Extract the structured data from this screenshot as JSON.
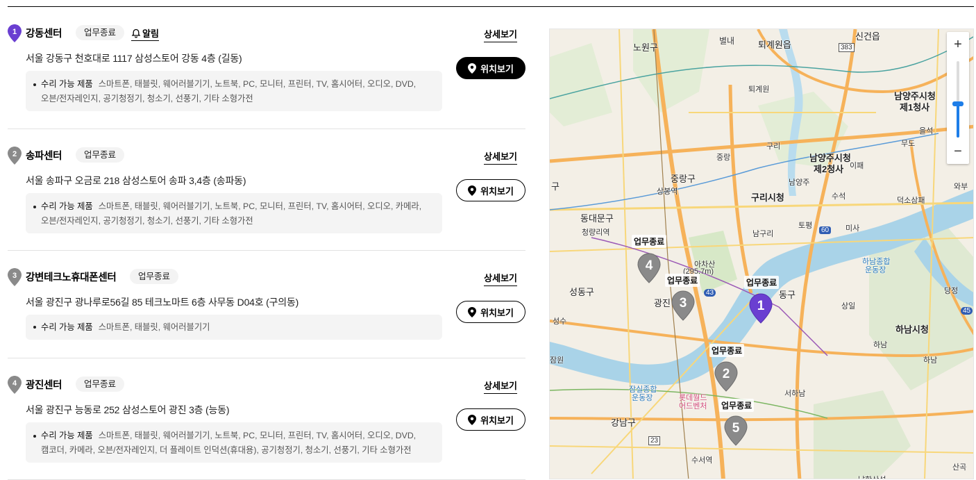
{
  "centers": [
    {
      "number": "1",
      "name": "강동센터",
      "status": "업무종료",
      "alarm_label": "알림",
      "address": "서울 강동구 천호대로 1117 삼성스토어 강동 4층 (길동)",
      "products_label": "수리 가능 제품",
      "products_line1": "스마트폰, 태블릿, 웨어러블기기, 노트북, PC, 모니터, 프린터, TV, 홈시어터, 오디오, DVD,",
      "products_line2": "오븐/전자레인지, 공기청정기, 청소기, 선풍기, 기타 소형가전",
      "detail_label": "상세보기",
      "location_label": "위치보기",
      "pin_color": "#6a3fd1"
    },
    {
      "number": "2",
      "name": "송파센터",
      "status": "업무종료",
      "address": "서울 송파구 오금로 218 삼성스토어 송파 3,4층 (송파동)",
      "products_label": "수리 가능 제품",
      "products_line1": "스마트폰, 태블릿, 웨어러블기기, 노트북, PC, 모니터, 프린터, TV, 홈시어터, 오디오, 카메라,",
      "products_line2": "오븐/전자레인지, 공기청정기, 청소기, 선풍기, 기타 소형가전",
      "detail_label": "상세보기",
      "location_label": "위치보기",
      "pin_color": "#8a8a8a"
    },
    {
      "number": "3",
      "name": "강변테크노휴대폰센터",
      "status": "업무종료",
      "address": "서울 광진구 광나루로56길 85 테크노마트 6층 사무동 D04호 (구의동)",
      "products_label": "수리 가능 제품",
      "products_line1": "스마트폰, 태블릿, 웨어러블기기",
      "products_line2": "",
      "detail_label": "상세보기",
      "location_label": "위치보기",
      "pin_color": "#8a8a8a"
    },
    {
      "number": "4",
      "name": "광진센터",
      "status": "업무종료",
      "address": "서울 광진구 능동로 252 삼성스토어 광진 3층 (능동)",
      "products_label": "수리 가능 제품",
      "products_line1": "스마트폰, 태블릿, 웨어러블기기, 노트북, PC, 모니터, 프린터, TV, 홈시어터, 오디오, DVD,",
      "products_line2": "캠코더, 카메라, 오븐/전자레인지, 더 플레이트 인덕션(휴대용), 공기청정기, 청소기, 선풍기, 기타 소형가전",
      "detail_label": "상세보기",
      "location_label": "위치보기",
      "pin_color": "#8a8a8a"
    }
  ],
  "map": {
    "labels": {
      "nowon": "노원구",
      "byeollae": "별내",
      "toegyewon": "퇴계원읍",
      "singeonji": "신건읍",
      "toegyewon_ic": "퇴계원",
      "namyangju1": "남양주시청",
      "namyangju1b": "제1청사",
      "namyangju2": "남양주시청",
      "namyangju2b": "제2청사",
      "jungnang": "중랑구",
      "sangbong": "상봉역",
      "guri": "구리시청",
      "gu": "구",
      "dongdaemun": "동대문구",
      "cheongnyangni": "청량리역",
      "achasan": "아차산",
      "achasan_h": "(295.7m)",
      "seongdong": "성동구",
      "gwangjin": "광진",
      "gangdong": "동구",
      "hanam": "하남시청",
      "hanam_sports": "하남종합",
      "hanam_sports2": "운동장",
      "jamsil_sports": "잠실종합",
      "jamsil_sports2": "운동장",
      "lotteworld": "롯데월드",
      "lotteworld2": "어드벤처",
      "gangnam": "강남구",
      "suseo": "수서역",
      "seoha": "서하남",
      "deokso": "덕소삼패",
      "dangjeong": "당정",
      "seongsu": "성수",
      "jamwon": "잠원",
      "sangil": "상일",
      "misa": "미사",
      "topyeong": "토평",
      "namgu": "남구리",
      "guri_ic": "구리",
      "jungnang_ic": "중랑",
      "namyangju_ic": "남양주",
      "sukseok": "수석",
      "ipae": "이패",
      "mude": "무도",
      "eulseok": "을석",
      "road_383": "383",
      "road_60": "60",
      "road_43": "43",
      "road_45": "45",
      "road_23": "23",
      "wabu": "와부",
      "hanam_ic": "하남",
      "sangok": "산곡",
      "hanam_south": "하남",
      "hanam_ic2": "하남",
      "namhan": "남한산성"
    },
    "statuses": {
      "s4": "업무종료",
      "s3": "업무종료",
      "s1": "업무종료",
      "s2": "업무종료",
      "s5": "업무종료"
    },
    "pins": {
      "p4": "4",
      "p3": "3",
      "p1": "1",
      "p2": "2",
      "p5": "5"
    },
    "zoom_in": "+",
    "zoom_out": "−",
    "zoom_level_fraction": 0.45,
    "colors": {
      "river": "#a9d3e8",
      "land": "#f3efe6",
      "park": "#d7e8c7",
      "highway": "#f6b25a",
      "road": "#f8d77a",
      "active_pin": "#6a3fd1",
      "inactive_pin": "#8a8a8a"
    }
  }
}
